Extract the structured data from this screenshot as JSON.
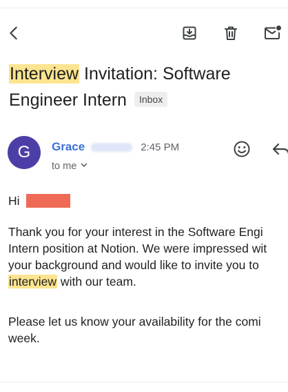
{
  "toolbar": {
    "back_icon": "arrow-back-icon",
    "archive_icon": "archive-icon",
    "delete_icon": "trash-icon",
    "mark_unread_icon": "mail-unread-icon"
  },
  "subject": {
    "highlighted_word": "Interview",
    "line1_rest": " Invitation: Software",
    "line2": "Engineer Intern",
    "label_chip": "Inbox"
  },
  "sender": {
    "avatar_letter": "G",
    "avatar_color": "#4b3fa7",
    "name": "Grace",
    "time": "2:45 PM",
    "recipient": "to me"
  },
  "header_actions": {
    "emoji_icon": "smiley-icon",
    "reply_icon": "reply-icon"
  },
  "message": {
    "greeting": "Hi",
    "paragraph1": {
      "line1": "Thank you for your interest in the Software Engi",
      "line2": "Intern position at Notion. We were impressed wit",
      "line3": "your background and would like to invite you to",
      "line4_highlight": "interview",
      "line4_rest": " with our team."
    },
    "paragraph2": {
      "line1": "Please let us know your availability for the comi",
      "line2": "week."
    }
  },
  "colors": {
    "highlight": "#fce490",
    "sender_name": "#3b6fd8",
    "redaction": "#ee6a54"
  }
}
